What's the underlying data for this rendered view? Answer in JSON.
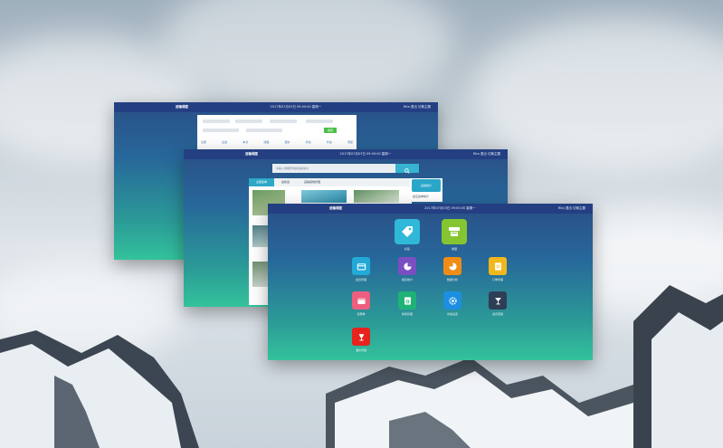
{
  "window_back": {
    "title": "运输调度",
    "status": "2017年07月03日 09:00:00 星期一",
    "user": "Rita  退出  切换主题",
    "search_button": "搜索",
    "nav_items": [
      "全部",
      "出发",
      "车次",
      "线路",
      "报价",
      "状态",
      "状态",
      "调度"
    ]
  },
  "window_mid": {
    "title": "运输调度",
    "status": "2017年07月03日 09:00:00 星期一",
    "user": "Rita  退出  切换主题",
    "search_placeholder": "请输入你要查询的运输信息",
    "tabs": [
      "全部运单",
      "最新运",
      "运输其他管理"
    ],
    "side_label": "运输统计",
    "side_caption": "最近运单统计"
  },
  "window_front": {
    "title": "运输调度",
    "status": "2017年07月03日 09:00:00 星期一",
    "user": "Rita  退出  切换主题",
    "apps": [
      {
        "label": "标签",
        "color": "#2fb8d7",
        "icon": "tag-icon"
      },
      {
        "label": "收银",
        "color": "#85c532",
        "icon": "register-icon"
      },
      {
        "label": "会员管理",
        "color": "#23a9d6",
        "icon": "card-icon"
      },
      {
        "label": "报表统计",
        "color": "#7a4fc2",
        "icon": "pie-chart-icon"
      },
      {
        "label": "数据分析",
        "color": "#ef8c16",
        "icon": "pie-chart-icon"
      },
      {
        "label": "订单管理",
        "color": "#f1b81c",
        "icon": "invoice-icon"
      },
      {
        "label": "优惠券",
        "color": "#ee5e7f",
        "icon": "coupon-icon"
      },
      {
        "label": "财务管理",
        "color": "#1fb277",
        "icon": "ledger-icon"
      },
      {
        "label": "系统设置",
        "color": "#1d8fe0",
        "icon": "gear-icon"
      },
      {
        "label": "会员营销",
        "color": "#2e3e55",
        "icon": "glass-icon"
      },
      {
        "label": "酒水管理",
        "color": "#e8231e",
        "icon": "wine-icon"
      }
    ]
  }
}
